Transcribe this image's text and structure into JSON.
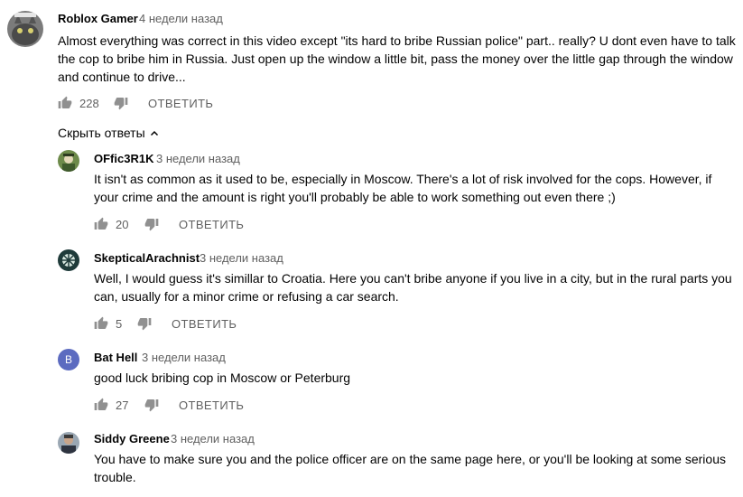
{
  "top_comment": {
    "author": "Roblox Gamer",
    "time": "4 недели назад",
    "text": "Almost everything was correct in this video except \"its hard to bribe Russian police\" part.. really? U dont even have to talk the cop to bribe him in Russia. Just open up the window a little bit, pass the money over the little gap through the window and continue to drive...",
    "likes": "228",
    "reply_label": "ОТВЕТИТЬ",
    "avatar_icon": "cat-avatar-icon"
  },
  "hide_replies_label": "Скрыть ответы",
  "replies": [
    {
      "author": "OFfic3R1K",
      "time": "3 недели назад",
      "text": "It isn't as common as it used to be, especially in Moscow. There's a lot of risk involved for the cops. However, if your crime and the amount is right you'll probably be able to work something out even there ;)",
      "likes": "20",
      "reply_label": "ОТВЕТИТЬ",
      "avatar_color": "#6d8a4a"
    },
    {
      "author": "SkepticalArachnist",
      "time": "3 недели назад",
      "text": "Well, I would guess it's simillar to Croatia. Here you can't bribe anyone if you live in a city, but in the rural parts you can, usually for a minor crime or refusing a car search.",
      "likes": "5",
      "reply_label": "ОТВЕТИТЬ",
      "avatar_color": "#1f3b3a"
    },
    {
      "author": "Bat Hell",
      "time": "3 недели назад",
      "text": "good luck bribing cop in Moscow or Peterburg",
      "likes": "27",
      "reply_label": "ОТВЕТИТЬ",
      "avatar_letter": "B",
      "avatar_color": "#5c6bc0"
    },
    {
      "author": "Siddy Greene",
      "time": "3 недели назад",
      "text": "You have to make sure you and the police officer are on the same page here, or you'll be looking at some serious trouble.",
      "avatar_color": "#9aa7b3"
    }
  ],
  "colors": {
    "text": "#030303",
    "secondary": "#606060",
    "icon": "#909090"
  }
}
